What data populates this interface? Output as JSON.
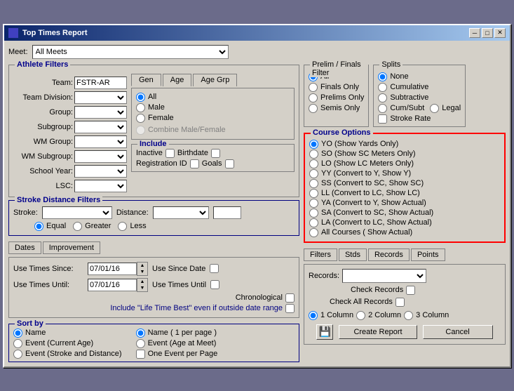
{
  "window": {
    "title": "Top Times Report",
    "minimize": "─",
    "maximize": "□",
    "close": "✕"
  },
  "meet": {
    "label": "Meet:",
    "value": "All Meets",
    "options": [
      "All Meets"
    ]
  },
  "athlete_filters": {
    "title": "Athlete Filters",
    "team_label": "Team:",
    "team_value": "FSTR-AR",
    "team_division_label": "Team Division:",
    "group_label": "Group:",
    "subgroup_label": "Subgroup:",
    "wm_group_label": "WM Group:",
    "wm_subgroup_label": "WM Subgroup:",
    "school_year_label": "School Year:",
    "lsc_label": "LSC:"
  },
  "gen_tab": {
    "label": "Gen",
    "all": "All",
    "male": "Male",
    "female": "Female",
    "combine": "Combine Male/Female"
  },
  "age_tab": {
    "label": "Age"
  },
  "age_grp_tab": {
    "label": "Age Grp"
  },
  "include": {
    "title": "Include",
    "inactive_label": "Inactive",
    "birthdate_label": "Birthdate",
    "registration_id_label": "Registration ID",
    "goals_label": "Goals"
  },
  "stroke_distance": {
    "title": "Stroke Distance Filters",
    "stroke_label": "Stroke:",
    "distance_label": "Distance:",
    "equal": "Equal",
    "greater": "Greater",
    "less": "Less"
  },
  "dates_tab": {
    "label": "Dates"
  },
  "improvement_tab": {
    "label": "Improvement"
  },
  "dates": {
    "use_times_since_label": "Use Times Since:",
    "use_times_since_value": "07/01/16",
    "use_times_until_label": "Use Times Until:",
    "use_times_until_value": "07/01/16",
    "use_since_date_label": "Use Since Date",
    "use_times_until_cb_label": "Use Times Until",
    "chronological_label": "Chronological",
    "lifetime_label": "Include \"Life Time Best\" even if outside date range"
  },
  "sort": {
    "title": "Sort by",
    "col1": [
      "Name",
      "Event (Current Age)",
      "Event (Stroke and Distance)"
    ],
    "col2": [
      "Name ( 1 per page )",
      "Event  (Age at Meet)",
      "One Event per Page"
    ]
  },
  "prelim_finals": {
    "title": "Prelim / Finals Filter",
    "all": "All",
    "finals_only": "Finals Only",
    "prelims_only": "Prelims Only",
    "semis_only": "Semis Only"
  },
  "splits": {
    "title": "Splits",
    "none": "None",
    "cumulative": "Cumulative",
    "subtractive": "Subtractive",
    "cum_subt": "Cum/Subt",
    "legal": "Legal",
    "stroke_rate": "Stroke Rate"
  },
  "course_options": {
    "title": "Course Options",
    "options": [
      "YO (Show Yards Only)",
      "SO (Show SC Meters Only)",
      "LO (Show LC Meters Only)",
      "YY (Convert to Y, Show Y)",
      "SS (Convert to SC, Show SC)",
      "LL (Convert to LC, Show LC)",
      "YA (Convert to Y, Show Actual)",
      "SA (Convert to SC, Show Actual)",
      "LA (Convert to LC, Show Actual)",
      "All Courses ( Show Actual)"
    ]
  },
  "bottom_right_tabs": {
    "filters": "Filters",
    "stds": "Stds",
    "records": "Records",
    "points": "Points"
  },
  "records_area": {
    "records_label": "Records:",
    "check_records_label": "Check Records",
    "check_all_records_label": "Check All Records",
    "one_column": "1 Column",
    "two_column": "2 Column",
    "three_column": "3 Column",
    "create_report": "Create Report",
    "cancel": "Cancel"
  }
}
